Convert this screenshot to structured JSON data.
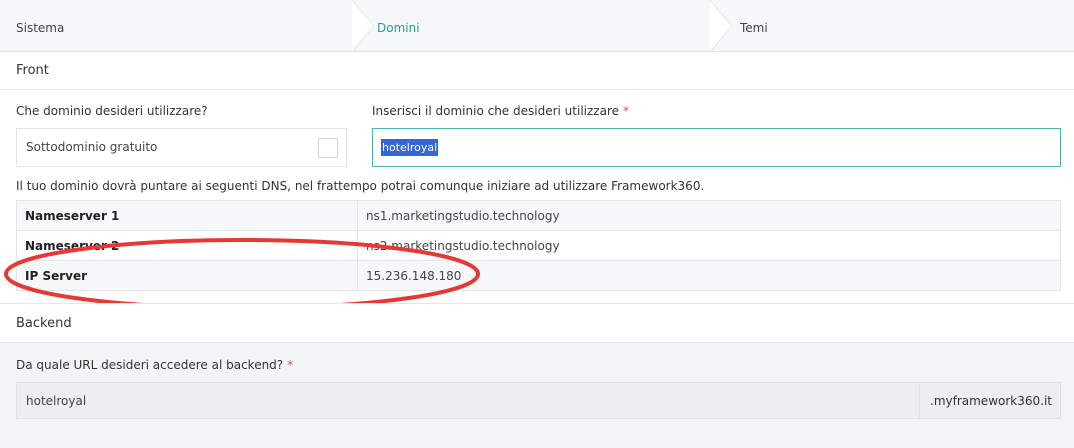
{
  "stepper": {
    "steps": [
      {
        "label": "Sistema",
        "state": "done"
      },
      {
        "label": "Domini",
        "state": "active"
      },
      {
        "label": "Temi",
        "state": "pending"
      }
    ],
    "active_color": "#2a9d8f"
  },
  "front": {
    "title": "Front",
    "domain_question": "Che dominio desideri utilizzare?",
    "free_subdomain_label": "Sottodominio gratuito",
    "free_subdomain_checked": false,
    "domain_input_label": "Inserisci il dominio che desideri utilizzare",
    "required_mark": "*",
    "domain_value": "hotelroyal",
    "dns_notice": "Il tuo dominio dovrà puntare ai seguenti DNS, nel frattempo potrai comunque iniziare ad utilizzare Framework360.",
    "dns_rows": [
      {
        "key": "Nameserver 1",
        "value": "ns1.marketingstudio.technology"
      },
      {
        "key": "Nameserver 2",
        "value": "ns2.marketingstudio.technology"
      },
      {
        "key": "IP Server",
        "value": "15.236.148.180"
      }
    ],
    "highlight_color": "#e53935"
  },
  "backend": {
    "title": "Backend",
    "url_question": "Da quale URL desideri accedere al backend?",
    "required_mark": "*",
    "url_value": "hotelroyal",
    "url_suffix": ".myframework360.it"
  }
}
